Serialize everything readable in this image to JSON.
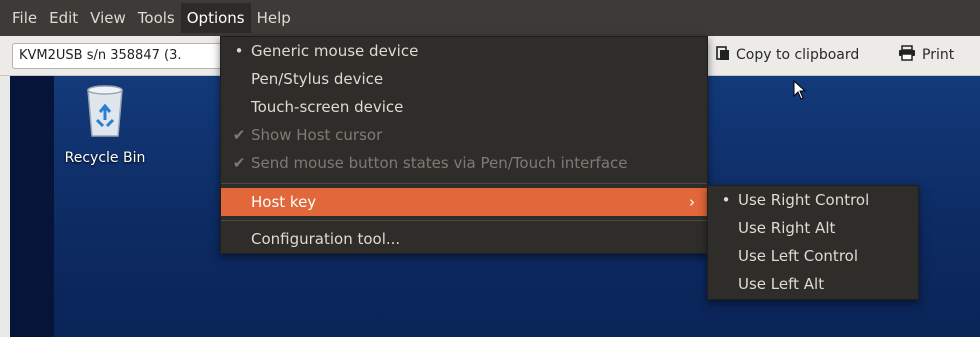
{
  "menubar": {
    "items": [
      "File",
      "Edit",
      "View",
      "Tools",
      "Options",
      "Help"
    ],
    "open_index": 4
  },
  "toolbar": {
    "device_value": "KVM2USB s/n 358847 (3.",
    "copy_label": "Copy to clipboard",
    "print_label": "Print"
  },
  "desktop": {
    "recycle_bin_label": "Recycle Bin"
  },
  "options_menu": {
    "generic_mouse": "Generic mouse device",
    "pen_stylus": "Pen/Stylus device",
    "touch_screen": "Touch-screen device",
    "show_host_cursor": "Show Host cursor",
    "send_mouse_button_states": "Send mouse button states via Pen/Touch interface",
    "host_key": "Host key",
    "configuration_tool": "Configuration tool..."
  },
  "host_key_submenu": {
    "use_right_control": "Use Right Control",
    "use_right_alt": "Use Right Alt",
    "use_left_control": "Use Left Control",
    "use_left_alt": "Use Left Alt"
  },
  "colors": {
    "menubar_bg": "#3c3b37",
    "menu_bg": "#2e2d29",
    "highlight": "#e2673a",
    "desktop_bg": "#10306b"
  }
}
